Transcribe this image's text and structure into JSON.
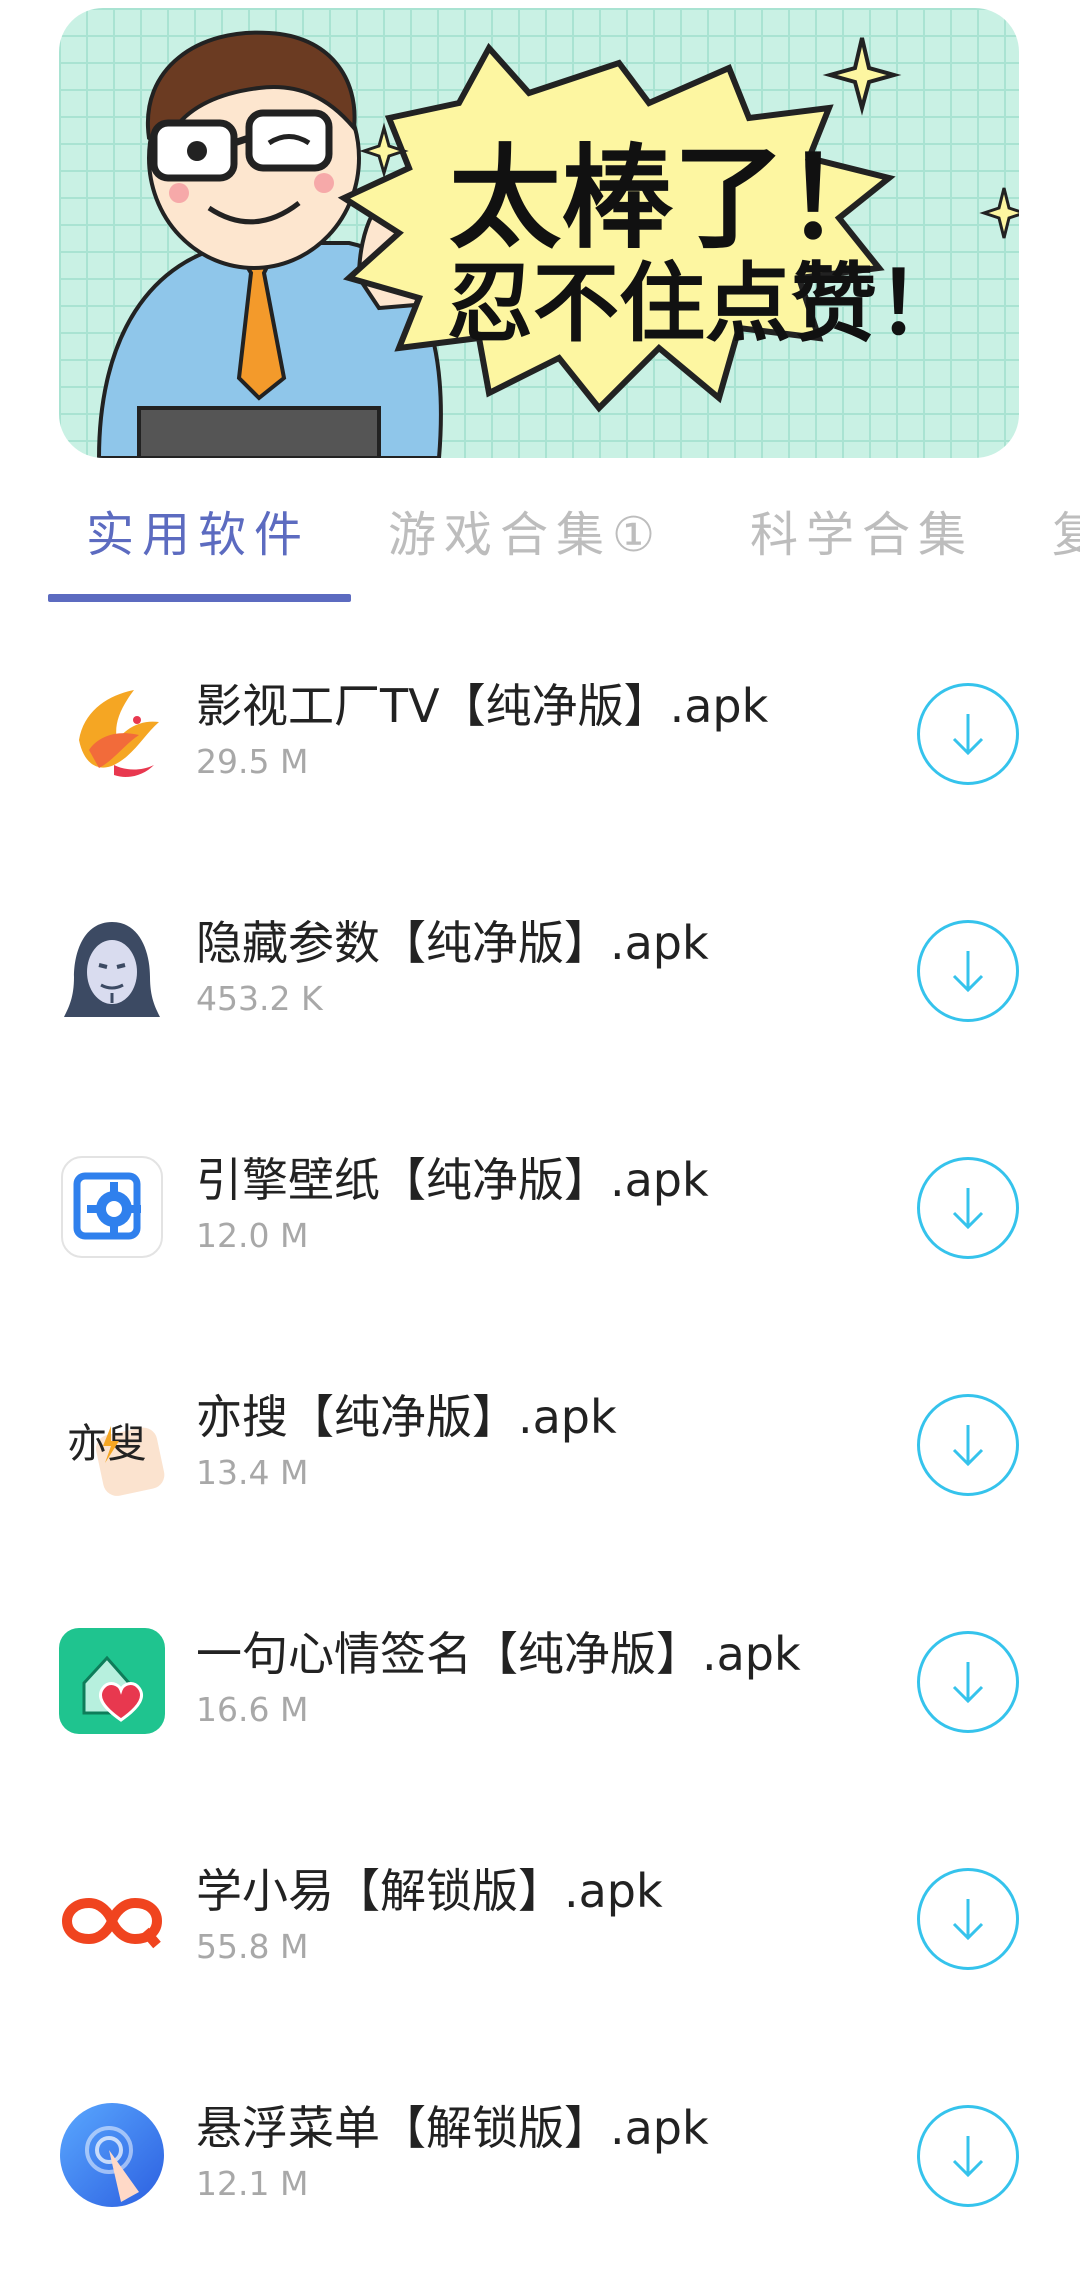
{
  "banner": {
    "headline": "太棒了！",
    "subline": "忍不住点赞！"
  },
  "tabs": [
    {
      "label": "实用软件",
      "active": true
    },
    {
      "label": "游戏合集①",
      "active": false
    },
    {
      "label": "科学合集",
      "active": false
    },
    {
      "label": "复",
      "active": false
    }
  ],
  "accent_color": "#5c6bc0",
  "download_color": "#35c3ec",
  "apps": [
    {
      "title": "影视工厂TV【纯净版】.apk",
      "size": "29.5 M",
      "icon": "phoenix-logo-icon"
    },
    {
      "title": "隐藏参数【纯净版】.apk",
      "size": "453.2 K",
      "icon": "hooded-mask-icon"
    },
    {
      "title": "引擎壁纸【纯净版】.apk",
      "size": "12.0 M",
      "icon": "gear-frame-icon"
    },
    {
      "title": "亦搜【纯净版】.apk",
      "size": "13.4 M",
      "icon": "yisou-logo-icon"
    },
    {
      "title": "一句心情签名【纯净版】.apk",
      "size": "16.6 M",
      "icon": "house-heart-icon"
    },
    {
      "title": "学小易【解锁版】.apk",
      "size": "55.8 M",
      "icon": "infinity-logo-icon"
    },
    {
      "title": "悬浮菜单【解锁版】.apk",
      "size": "12.1 M",
      "icon": "floating-touch-icon"
    }
  ]
}
